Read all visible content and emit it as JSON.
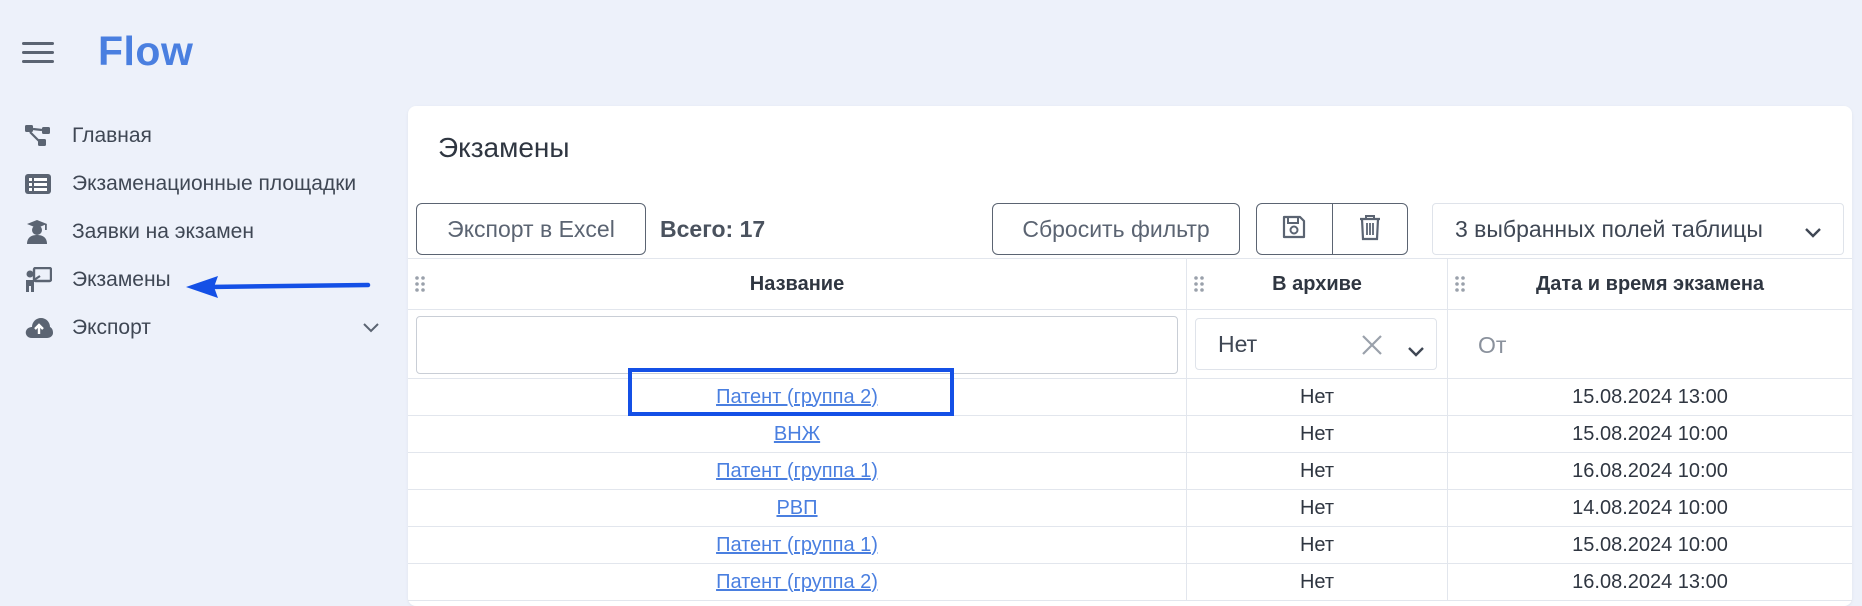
{
  "app": {
    "title": "Flow"
  },
  "sidebar": {
    "items": [
      {
        "label": "Главная",
        "icon": "network-icon"
      },
      {
        "label": "Экзаменационные площадки",
        "icon": "list-icon"
      },
      {
        "label": "Заявки на экзамен",
        "icon": "graduate-icon"
      },
      {
        "label": "Экзамены",
        "icon": "teacher-board-icon"
      },
      {
        "label": "Экспорт",
        "icon": "cloud-upload-icon"
      }
    ]
  },
  "page": {
    "title": "Экзамены"
  },
  "toolbar": {
    "export_label": "Экспорт в Excel",
    "total_label": "Всего: 17",
    "reset_label": "Сбросить фильтр",
    "fields_label": "3 выбранных полей таблицы"
  },
  "table": {
    "columns": [
      "Название",
      "В архиве",
      "Дата и время экзамена"
    ],
    "filters": {
      "name_value": "",
      "archive_value": "Нет",
      "date_from_placeholder": "От"
    },
    "rows": [
      {
        "name": "Патент (группа 2)",
        "archive": "Нет",
        "datetime": "15.08.2024 13:00"
      },
      {
        "name": "ВНЖ",
        "archive": "Нет",
        "datetime": "15.08.2024 10:00"
      },
      {
        "name": "Патент (группа 1)",
        "archive": "Нет",
        "datetime": "16.08.2024 10:00"
      },
      {
        "name": "РВП",
        "archive": "Нет",
        "datetime": "14.08.2024 10:00"
      },
      {
        "name": "Патент (группа 1)",
        "archive": "Нет",
        "datetime": "15.08.2024 10:00"
      },
      {
        "name": "Патент (группа 2)",
        "archive": "Нет",
        "datetime": "16.08.2024 13:00"
      }
    ]
  },
  "colors": {
    "accent": "#4a7fe0",
    "annotation": "#1450e6",
    "background": "#edf1fa"
  }
}
